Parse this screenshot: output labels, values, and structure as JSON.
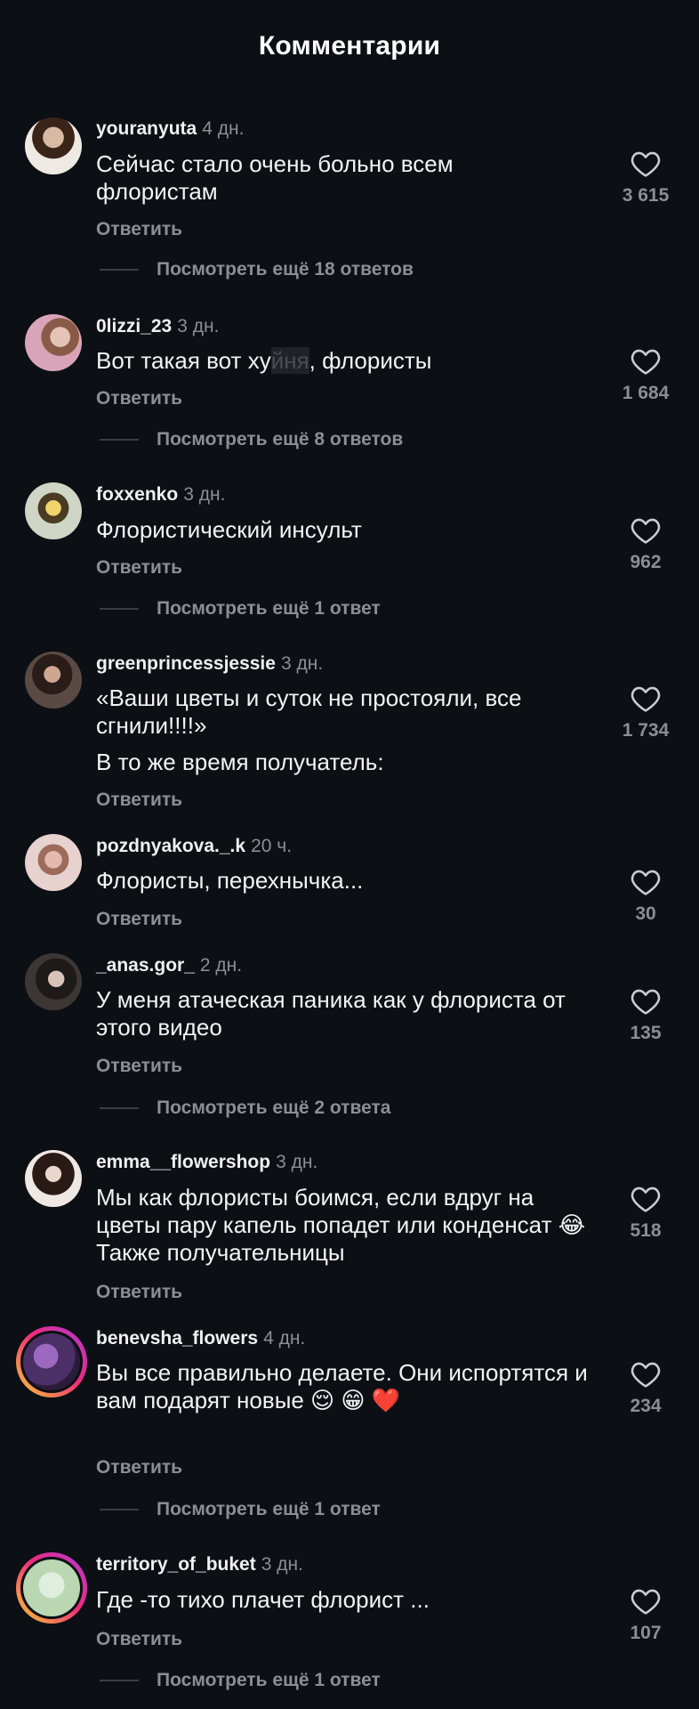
{
  "header": {
    "title": "Комментарии"
  },
  "reply_label": "Ответить",
  "comments": [
    {
      "username": "youranyuta",
      "time": "4 дн.",
      "text": "Сейчас стало очень больно всем флористам",
      "likes": "3 615",
      "more": "Посмотреть ещё 18 ответов"
    },
    {
      "username": "0lizzi_23",
      "time": "3 дн.",
      "text_before": "Вот такая вот ху",
      "text_censored": "йня",
      "text_after": ", флористы",
      "likes": "1 684",
      "more": "Посмотреть ещё 8 ответов"
    },
    {
      "username": "foxxenko",
      "time": "3 дн.",
      "text": "Флористический инсульт",
      "likes": "962",
      "more": "Посмотреть ещё 1 ответ"
    },
    {
      "username": "greenprincessjessie",
      "time": "3 дн.",
      "text": "«Ваши цветы и суток не простояли, все сгнили!!!!»",
      "text2": "В то же время получатель:",
      "likes": "1 734"
    },
    {
      "username": "pozdnyakova._.k",
      "time": "20 ч.",
      "text": "Флористы, перехнычка...",
      "likes": "30"
    },
    {
      "username": "_anas.gor_",
      "time": "2 дн.",
      "text": "У меня атаческая паника как у флориста от этого видео",
      "likes": "135",
      "more": "Посмотреть ещё 2 ответа"
    },
    {
      "username": "emma__flowershop",
      "time": "3 дн.",
      "text": "Мы как флористы боимся, если вдруг на цветы пару капель попадет или конденсат 😂 Также получательницы",
      "likes": "518"
    },
    {
      "username": "benevsha_flowers",
      "time": "4 дн.",
      "text": "Вы все правильно делаете. Они испортятся и вам подарят новые 😌 😁 ❤️",
      "likes": "234",
      "more": "Посмотреть ещё 1 ответ"
    },
    {
      "username": "territory_of_buket",
      "time": "3 дн.",
      "text": "Где -то тихо плачет флорист ...",
      "likes": "107",
      "more": "Посмотреть ещё 1 ответ"
    }
  ]
}
